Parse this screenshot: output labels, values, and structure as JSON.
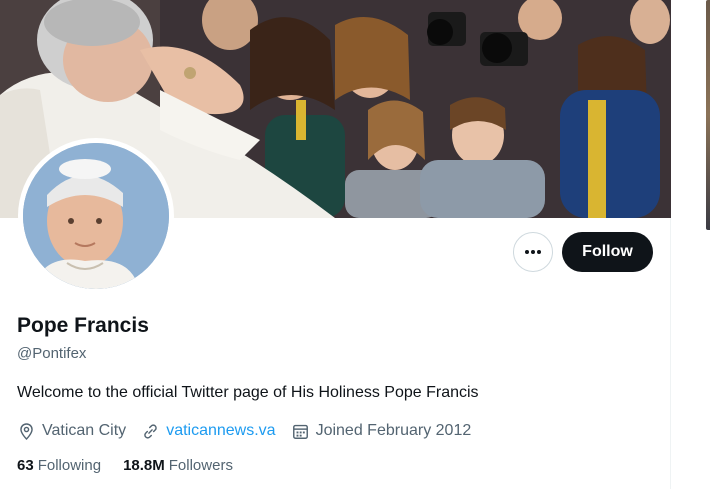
{
  "profile": {
    "display_name": "Pope Francis",
    "handle": "@Pontifex",
    "bio": "Welcome to the official Twitter page of His Holiness Pope Francis",
    "location": "Vatican City",
    "website": "vaticannews.va",
    "joined": "Joined February 2012",
    "following_count": "63",
    "following_label": "Following",
    "followers_count": "18.8M",
    "followers_label": "Followers"
  },
  "actions": {
    "follow_label": "Follow",
    "more_icon": "more-horizontal-icon"
  },
  "icons": {
    "location": "location-pin-icon",
    "website": "link-icon",
    "joined": "calendar-icon"
  },
  "colors": {
    "accent": "#1d9bf0",
    "text_primary": "#0f1419",
    "text_secondary": "#536471",
    "follow_button": "#0f1419"
  }
}
